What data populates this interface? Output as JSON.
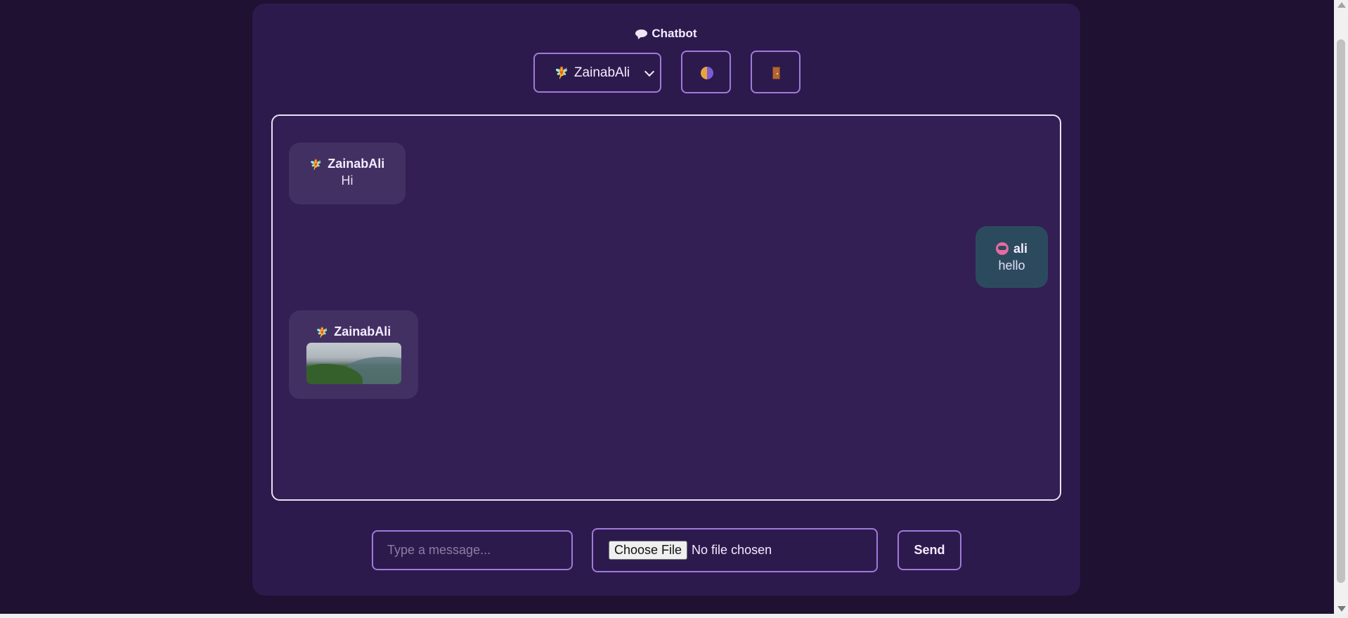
{
  "header": {
    "title": "Chatbot",
    "title_icon": "speech-bubble-icon"
  },
  "controls": {
    "selected_user": "ZainabAli",
    "selected_user_emoji": "🧚",
    "theme_icon": "theme-toggle-icon",
    "logout_icon": "door-icon"
  },
  "messages": [
    {
      "sender": "ZainabAli",
      "emoji": "🧚",
      "text": "Hi",
      "side": "left"
    },
    {
      "sender": "ali",
      "icon": "robot-face-icon",
      "text": "hello",
      "side": "right"
    },
    {
      "sender": "ZainabAli",
      "emoji": "🧚",
      "attachment": "mountain-landscape-photo",
      "side": "left"
    }
  ],
  "composer": {
    "message_placeholder": "Type a message...",
    "choose_file_label": "Choose File",
    "file_status": "No file chosen",
    "send_label": "Send"
  },
  "colors": {
    "background": "#1e1131",
    "panel": "#2d1a4d",
    "accent_border": "#a07ad8",
    "bot_bubble": "#433063",
    "user_bubble": "#2c4a5e"
  }
}
